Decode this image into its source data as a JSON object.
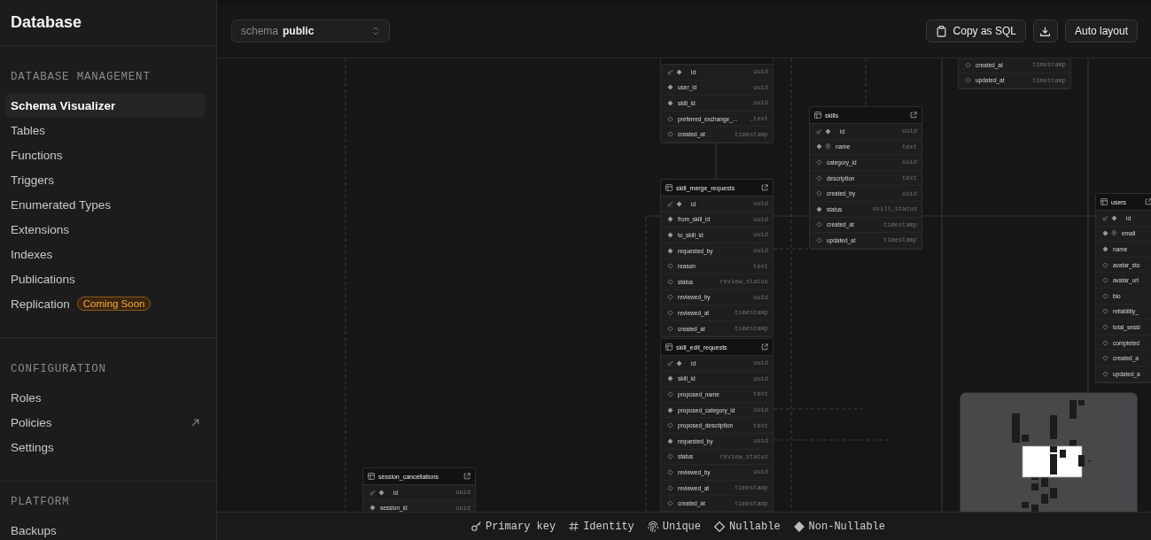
{
  "sidebar": {
    "title": "Database",
    "sections": [
      {
        "heading": "DATABASE MANAGEMENT",
        "items": [
          {
            "label": "Schema Visualizer",
            "selected": true
          },
          {
            "label": "Tables",
            "selected": false
          },
          {
            "label": "Functions",
            "selected": false
          },
          {
            "label": "Triggers",
            "selected": false
          },
          {
            "label": "Enumerated Types",
            "selected": false
          },
          {
            "label": "Extensions",
            "selected": false
          },
          {
            "label": "Indexes",
            "selected": false
          },
          {
            "label": "Publications",
            "selected": false
          },
          {
            "label": "Replication",
            "selected": false,
            "badge": "Coming Soon"
          }
        ]
      },
      {
        "heading": "CONFIGURATION",
        "items": [
          {
            "label": "Roles",
            "selected": false
          },
          {
            "label": "Policies",
            "selected": false,
            "external": true
          },
          {
            "label": "Settings",
            "selected": false
          }
        ]
      },
      {
        "heading": "PLATFORM",
        "items": [
          {
            "label": "Backups",
            "selected": false
          }
        ]
      }
    ]
  },
  "toolbar": {
    "schema_label": "schema",
    "schema_value": "public",
    "buttons": [
      {
        "kind": "copy",
        "label": "Copy as SQL"
      },
      {
        "kind": "download"
      },
      {
        "kind": "plain",
        "label": "Auto layout"
      }
    ]
  },
  "diagram": {
    "tables": [
      {
        "columns": [
          {
            "name": "id",
            "type": "uuid",
            "key": true,
            "nullable": false
          },
          {
            "name": "user_id",
            "type": "uuid",
            "nullable": false
          },
          {
            "name": "skill_id",
            "type": "uuid",
            "nullable": false
          },
          {
            "name": "preferred_exchange_...",
            "type": "_text",
            "nullable": true
          },
          {
            "name": "created_at",
            "type": "timestamp",
            "nullable": true
          }
        ]
      },
      {
        "name": "skill_merge_requests",
        "columns": [
          {
            "name": "id",
            "type": "uuid",
            "key": true,
            "nullable": false
          },
          {
            "name": "from_skill_id",
            "type": "uuid",
            "nullable": false
          },
          {
            "name": "to_skill_id",
            "type": "uuid",
            "nullable": false
          },
          {
            "name": "requested_by",
            "type": "uuid",
            "nullable": false
          },
          {
            "name": "reason",
            "type": "text",
            "nullable": true
          },
          {
            "name": "status",
            "type": "review_status",
            "nullable": true
          },
          {
            "name": "reviewed_by",
            "type": "uuid",
            "nullable": true
          },
          {
            "name": "reviewed_at",
            "type": "timestamp",
            "nullable": true
          },
          {
            "name": "created_at",
            "type": "timestamp",
            "nullable": true
          }
        ]
      },
      {
        "name": "skill_edit_requests",
        "columns": [
          {
            "name": "id",
            "type": "uuid",
            "key": true,
            "nullable": false
          },
          {
            "name": "skill_id",
            "type": "uuid",
            "nullable": false
          },
          {
            "name": "proposed_name",
            "type": "text",
            "nullable": true
          },
          {
            "name": "proposed_category_id",
            "type": "uuid",
            "nullable": false
          },
          {
            "name": "proposed_description",
            "type": "text",
            "nullable": true
          },
          {
            "name": "requested_by",
            "type": "uuid",
            "nullable": false
          },
          {
            "name": "status",
            "type": "review_status",
            "nullable": true
          },
          {
            "name": "reviewed_by",
            "type": "uuid",
            "nullable": true
          },
          {
            "name": "reviewed_at",
            "type": "timestamp",
            "nullable": true
          },
          {
            "name": "created_at",
            "type": "timestamp",
            "nullable": true
          }
        ]
      },
      {
        "name": "skills",
        "columns": [
          {
            "name": "id",
            "type": "uuid",
            "key": true,
            "nullable": false
          },
          {
            "name": "name",
            "type": "text",
            "unique": true,
            "nullable": false
          },
          {
            "name": "category_id",
            "type": "uuid",
            "nullable": true
          },
          {
            "name": "description",
            "type": "text",
            "nullable": true
          },
          {
            "name": "created_by",
            "type": "uuid",
            "nullable": true
          },
          {
            "name": "status",
            "type": "skill_status",
            "nullable": false
          },
          {
            "name": "created_at",
            "type": "timestamp",
            "nullable": true
          },
          {
            "name": "updated_at",
            "type": "timestamp",
            "nullable": true
          }
        ]
      },
      {
        "columns": [
          {
            "name": "created_at",
            "type": "timestamp",
            "nullable": true
          },
          {
            "name": "updated_at",
            "type": "timestamp",
            "nullable": true
          }
        ]
      },
      {
        "name": "users",
        "columns": [
          {
            "name": "id",
            "key": true,
            "nullable": false
          },
          {
            "name": "email",
            "unique": true,
            "nullable": false
          },
          {
            "name": "name",
            "nullable": false
          },
          {
            "name": "avatar_sto",
            "nullable": true
          },
          {
            "name": "avatar_url",
            "nullable": true
          },
          {
            "name": "bio",
            "nullable": true
          },
          {
            "name": "reliability_",
            "nullable": true
          },
          {
            "name": "total_sessi",
            "nullable": true
          },
          {
            "name": "completed",
            "nullable": true
          },
          {
            "name": "created_a",
            "nullable": true
          },
          {
            "name": "updated_a",
            "nullable": true
          }
        ]
      },
      {
        "name": "session_cancellations",
        "columns": [
          {
            "name": "id",
            "type": "uuid",
            "key": true,
            "nullable": false
          },
          {
            "name": "session_id",
            "type": "uuid",
            "nullable": false
          }
        ]
      }
    ]
  },
  "legend": [
    {
      "kind": "key",
      "label": "Primary key"
    },
    {
      "kind": "identity",
      "label": "Identity"
    },
    {
      "kind": "unique",
      "label": "Unique"
    },
    {
      "kind": "nullable",
      "label": "Nullable"
    },
    {
      "kind": "nonnull",
      "label": "Non-Nullable"
    }
  ]
}
